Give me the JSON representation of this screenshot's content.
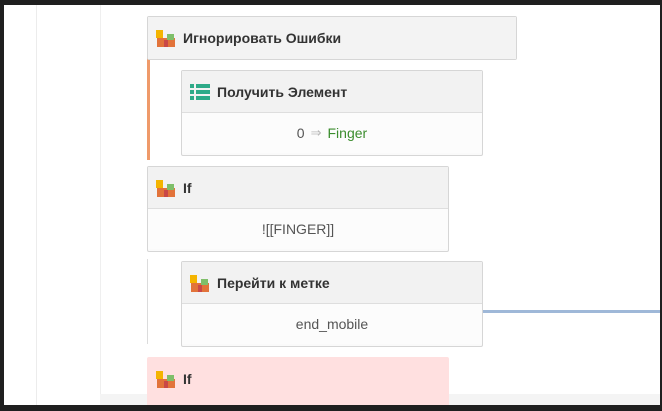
{
  "blocks": {
    "ignore_errors": {
      "title": "Игнорировать Ошибки"
    },
    "get_element": {
      "title": "Получить Элемент",
      "index": "0",
      "arrow": "⇒",
      "target": "Finger"
    },
    "if1": {
      "title": "If",
      "condition": "![[FINGER]]"
    },
    "goto_label": {
      "title": "Перейти к метке",
      "label": "end_mobile"
    },
    "if2": {
      "title": "If"
    }
  },
  "icons": {
    "flow": "flow-block-icon",
    "list": "list-icon"
  },
  "colors": {
    "branch_bar": "#ef9a6a",
    "connector": "#9fb8d8",
    "target_text": "#3b8d2e",
    "error_block": "#ffe0e0",
    "list_icon": "#2eaa88"
  }
}
